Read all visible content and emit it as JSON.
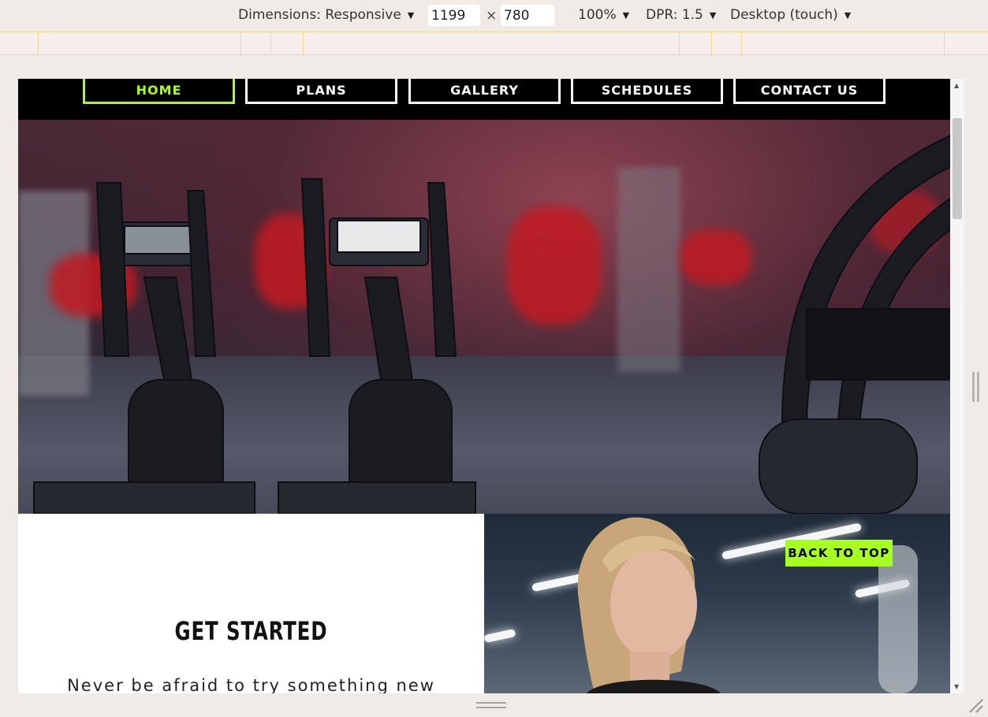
{
  "devtools": {
    "dimensions_label": "Dimensions: Responsive",
    "width_value": "1199",
    "height_value": "780",
    "times": "×",
    "zoom": "100%",
    "dpr": "DPR: 1.5",
    "device_mode": "Desktop (touch)"
  },
  "nav": {
    "items": [
      {
        "label": "HOME",
        "active": true
      },
      {
        "label": "PLANS",
        "active": false
      },
      {
        "label": "GALLERY",
        "active": false
      },
      {
        "label": "SCHEDULES",
        "active": false
      },
      {
        "label": "CONTACT US",
        "active": false
      }
    ]
  },
  "get_started": {
    "title": "GET STARTED",
    "text": "Never be afraid to try something new"
  },
  "back_to_top": "BACK TO TOP",
  "colors": {
    "accent": "#a6ff20",
    "nav_bg": "#000000",
    "devtools_bg": "#f0ebe6"
  }
}
